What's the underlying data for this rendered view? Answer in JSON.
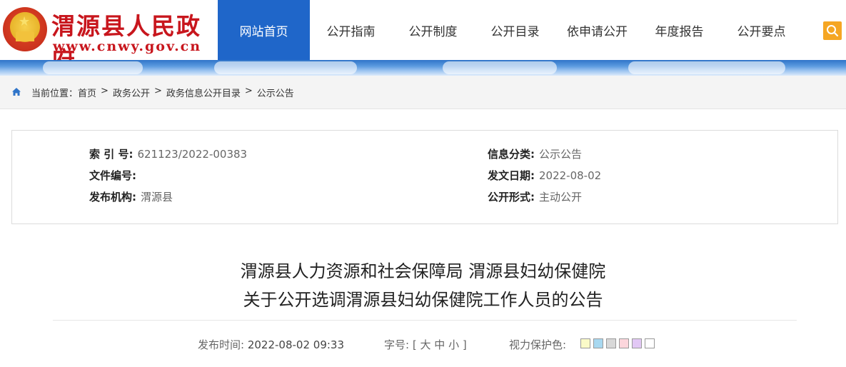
{
  "header": {
    "site_name": "渭源县人民政府",
    "site_url": "www.cnwy.gov.cn"
  },
  "nav": {
    "items": [
      {
        "label": "网站首页",
        "active": true
      },
      {
        "label": "公开指南",
        "active": false
      },
      {
        "label": "公开制度",
        "active": false
      },
      {
        "label": "公开目录",
        "active": false
      },
      {
        "label": "依申请公开",
        "active": false
      },
      {
        "label": "年度报告",
        "active": false
      },
      {
        "label": "公开要点",
        "active": false
      }
    ],
    "active_color": "#1f66c9",
    "search_icon": "search-icon"
  },
  "breadcrumb": {
    "prefix": "当前位置：",
    "items": [
      "首页",
      "政务公开",
      "政务信息公开目录",
      "公示公告"
    ],
    "separator": ">"
  },
  "info": {
    "index_label": "索 引 号:",
    "index_value": "621123/2022-00383",
    "doc_no_label": "文件编号:",
    "doc_no_value": "",
    "publisher_label": "发布机构:",
    "publisher_value": "渭源县",
    "category_label": "信息分类:",
    "category_value": "公示公告",
    "date_label": "发文日期:",
    "date_value": "2022-08-02",
    "form_label": "公开形式:",
    "form_value": "主动公开"
  },
  "article": {
    "title_line1": "渭源县人力资源和社会保障局 渭源县妇幼保健院",
    "title_line2": "关于公开选调渭源县妇幼保健院工作人员的公告",
    "publish_label": "发布时间:",
    "publish_time": "2022-08-02 09:33",
    "font_label": "字号:",
    "font_open": "[",
    "font_large": "大",
    "font_medium": "中",
    "font_small": "小",
    "font_close": "]",
    "eye_label": "视力保护色:",
    "eye_colors": [
      "#fafac8",
      "#a8d8f0",
      "#d8d8d8",
      "#fcd6dc",
      "#e2c8f5",
      "#ffffff"
    ]
  }
}
